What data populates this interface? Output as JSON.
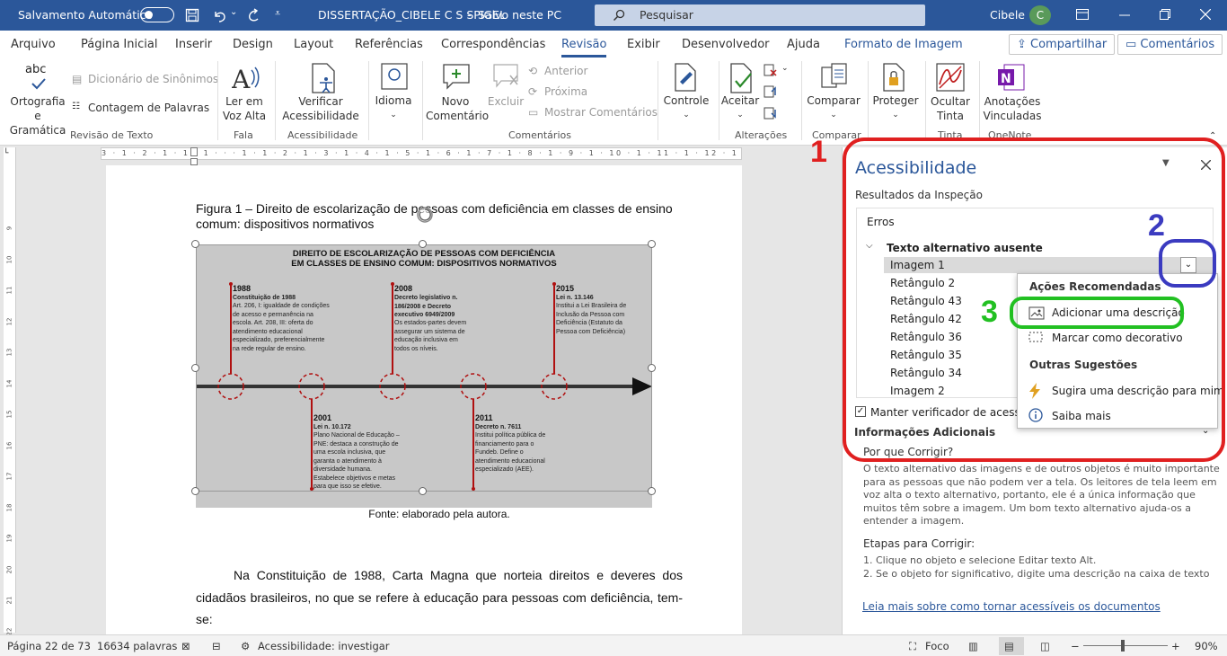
{
  "titlebar": {
    "autosave_label": "Salvamento Automático",
    "filename": "DISSERTAÇÃO_CIBELE C S SPIGEL",
    "save_status": "Salvo neste PC",
    "search_placeholder": "Pesquisar",
    "user_name": "Cibele",
    "user_initial": "C"
  },
  "tabs": [
    "Arquivo",
    "Página Inicial",
    "Inserir",
    "Design",
    "Layout",
    "Referências",
    "Correspondências",
    "Revisão",
    "Exibir",
    "Desenvolvedor",
    "Ajuda",
    "Formato de Imagem"
  ],
  "share_label": "Compartilhar",
  "comments_label": "Comentários",
  "ribbon": {
    "spelling": "Ortografia\ne Gramática",
    "thesaurus": "Dicionário de Sinônimos",
    "wordcount": "Contagem de Palavras",
    "group_revisao_texto": "Revisão de Texto",
    "read_aloud": "Ler em\nVoz Alta",
    "group_fala": "Fala",
    "check_access": "Verificar\nAcessibilidade",
    "group_acess": "Acessibilidade",
    "language": "Idioma",
    "new_comment": "Novo\nComentário",
    "delete": "Excluir",
    "previous": "Anterior",
    "next": "Próxima",
    "show_comments": "Mostrar Comentários",
    "group_comentarios": "Comentários",
    "tracking": "Controle",
    "accept": "Aceitar",
    "group_alteracoes": "Alterações",
    "compare": "Comparar",
    "group_comparar": "Comparar",
    "protect": "Proteger",
    "hide_ink": "Ocultar\nTinta",
    "group_tinta": "Tinta",
    "linked_notes": "Anotações\nVinculadas",
    "group_onenote": "OneNote"
  },
  "ruler_text": "3 · 1 · 2 · 1 · 1 · 1 · · · 1 · 1 · 2 · 1 · 3 · 1 · 4 · 1 · 5 · 1 · 6 · 1 · 7 · 1 · 8 · 1 · 9 · 1 · 10 · 1 · 11 · 1 · 12 · 1 · 13 · 1 · 14 · 1 · 15 · 1 · 16 · 1 · 17 · 1 ·",
  "vruler_numbers": [
    "9",
    "10",
    "11",
    "12",
    "13",
    "14",
    "15",
    "16",
    "17",
    "18",
    "19",
    "20",
    "21",
    "22",
    "23"
  ],
  "document": {
    "caption": "Figura 1 – Direito de escolarização de pessoas com deficiência em classes de ensino comum: dispositivos normativos",
    "source": "Fonte: elaborado pela autora.",
    "body": "Na Constituição de 1988, Carta Magna que norteia direitos e deveres dos cidadãos brasileiros, no que se refere à educação para pessoas com deficiência, tem-se:"
  },
  "figure": {
    "title_line1": "DIREITO DE ESCOLARIZAÇÃO DE PESSOAS COM DEFICIÊNCIA",
    "title_line2": "EM CLASSES DE ENSINO COMUM: DISPOSITIVOS NORMATIVOS",
    "events": [
      {
        "year": "1988",
        "subtitle": "Constituição de 1988",
        "text": "Art. 206, I: igualdade de condições de acesso e permanência na escola. Art. 208, III: oferta do atendimento educacional especializado, preferencialmente na rede regular de ensino."
      },
      {
        "year": "2001",
        "subtitle": "Lei n. 10.172",
        "text": "Plano Nacional de Educação – PNE: destaca a construção de uma escola inclusiva, que garanta o atendimento à diversidade humana. Estabelece objetivos e metas para que isso se efetive."
      },
      {
        "year": "2008",
        "subtitle": "Decreto legislativo n. 186/2008 e Decreto executivo 6949/2009",
        "text": "Os estados-partes devem assegurar um sistema de educação inclusiva em todos os níveis."
      },
      {
        "year": "2011",
        "subtitle": "Decreto n. 7611",
        "text": "Institui política pública de financiamento para o Fundeb. Define o atendimento educacional especializado (AEE)."
      },
      {
        "year": "2015",
        "subtitle": "Lei n. 13.146",
        "text": "Institui a Lei Brasileira de Inclusão da Pessoa com Deficiência (Estatuto da Pessoa com Deficiência)"
      }
    ]
  },
  "pane": {
    "title": "Acessibilidade",
    "results_label": "Resultados da Inspeção",
    "errors_label": "Erros",
    "group_label": "Texto alternativo ausente",
    "items": [
      "Imagem 1",
      "Retângulo 2",
      "Retângulo 43",
      "Retângulo 42",
      "Retângulo 36",
      "Retângulo 35",
      "Retângulo 34",
      "Imagem 2"
    ],
    "keep_checker": "Manter verificador de acessibilidade",
    "additional_info": "Informações Adicionais",
    "why_fix": "Por que Corrigir?",
    "why_lines": [
      "O texto alternativo das imagens e de outros objetos é muito importante",
      "para as pessoas que não podem ver a tela. Os leitores de tela leem em",
      "voz alta o texto alternativo, portanto, ele é a única informação que",
      "muitos têm sobre a imagem. Um bom texto alternativo ajuda-os a",
      "entender a imagem."
    ],
    "steps_label": "Etapas para Corrigir:",
    "step1": "1. Clique no objeto e selecione Editar texto Alt.",
    "step2": "2. Se o objeto for significativo, digite uma descrição na caixa de texto",
    "learn_more": "Leia mais sobre como tornar acessíveis os documentos"
  },
  "menu": {
    "recommended": "Ações Recomendadas",
    "add_description": "Adicionar uma descrição",
    "mark_decorative": "Marcar como decorativo",
    "other": "Outras Sugestões",
    "suggest": "Sugira uma descrição para mim",
    "learn": "Saiba mais"
  },
  "annotations": {
    "n1": "1",
    "n2": "2",
    "n3": "3"
  },
  "status": {
    "page": "Página 22 de 73",
    "words": "16634 palavras",
    "accessibility": "Acessibilidade: investigar",
    "focus": "Foco",
    "zoom": "90%"
  },
  "colors": {
    "accent": "#2b579a",
    "annotation_red": "#e02020",
    "annotation_blue": "#3b3bc0",
    "annotation_green": "#22c022",
    "timeline_red": "#b01010"
  }
}
